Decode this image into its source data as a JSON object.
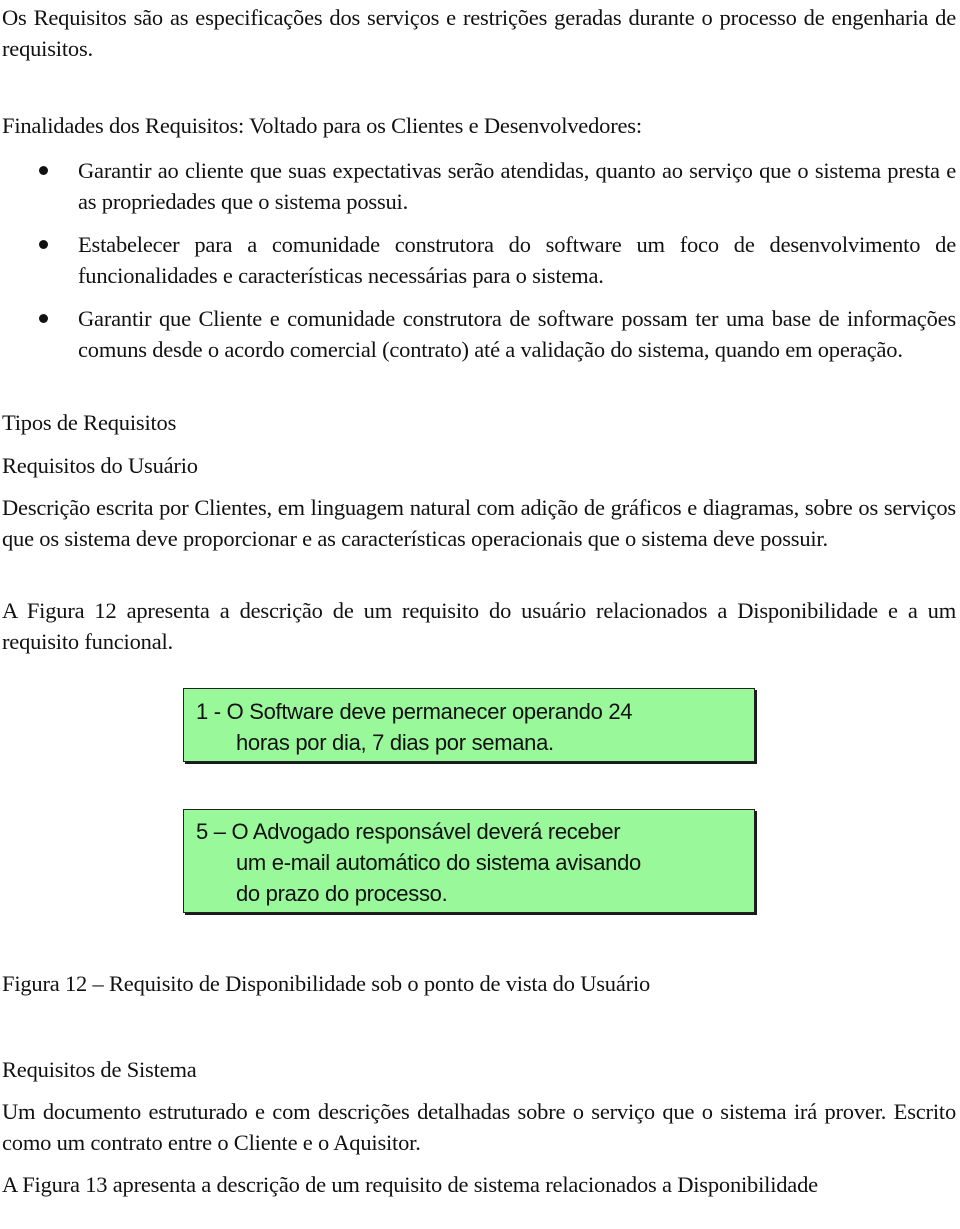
{
  "intro": {
    "text": "Os Requisitos são as especificações dos serviços e restrições geradas durante o processo de engenharia de requisitos."
  },
  "finalidades": {
    "heading": "Finalidades dos Requisitos: Voltado para os Clientes e Desenvolvedores:",
    "bullets": [
      "Garantir ao cliente que suas expectativas serão atendidas, quanto ao serviço que o sistema presta e as propriedades que o sistema possui.",
      "Estabelecer para a comunidade construtora do software um foco de desenvolvimento de funcionalidades e características necessárias para o sistema.",
      "Garantir que Cliente e comunidade construtora de software possam ter uma base de informações comuns desde o acordo comercial (contrato) até a validação do sistema, quando em operação."
    ]
  },
  "tipos": {
    "heading": "Tipos de Requisitos"
  },
  "usuario": {
    "heading": "Requisitos do Usuário",
    "description": "Descrição escrita por Clientes, em linguagem natural com adição de gráficos e diagramas, sobre os serviços que os sistema deve proporcionar e as características operacionais que o sistema deve possuir.",
    "figure_intro": "A Figura 12 apresenta a descrição de um requisito do usuário relacionados a Disponibilidade e a um requisito funcional."
  },
  "figure12": {
    "box_color": "#99f899",
    "boxes": [
      {
        "lines": [
          "1 - O Software deve permanecer operando 24",
          "horas por dia, 7 dias por semana."
        ]
      },
      {
        "lines": [
          "5 – O Advogado responsável deverá receber",
          "um e-mail automático do sistema avisando",
          "do prazo do processo."
        ]
      }
    ],
    "caption": "Figura 12 – Requisito de Disponibilidade sob o ponto de vista do Usuário"
  },
  "sistema": {
    "heading": "Requisitos de Sistema",
    "description": "Um documento estruturado e com descrições detalhadas sobre o serviço que o sistema irá prover. Escrito como um contrato entre o Cliente e o Aquisitor.",
    "figure_intro": "A Figura 13 apresenta a descrição de um requisito de sistema relacionados a Disponibilidade"
  }
}
